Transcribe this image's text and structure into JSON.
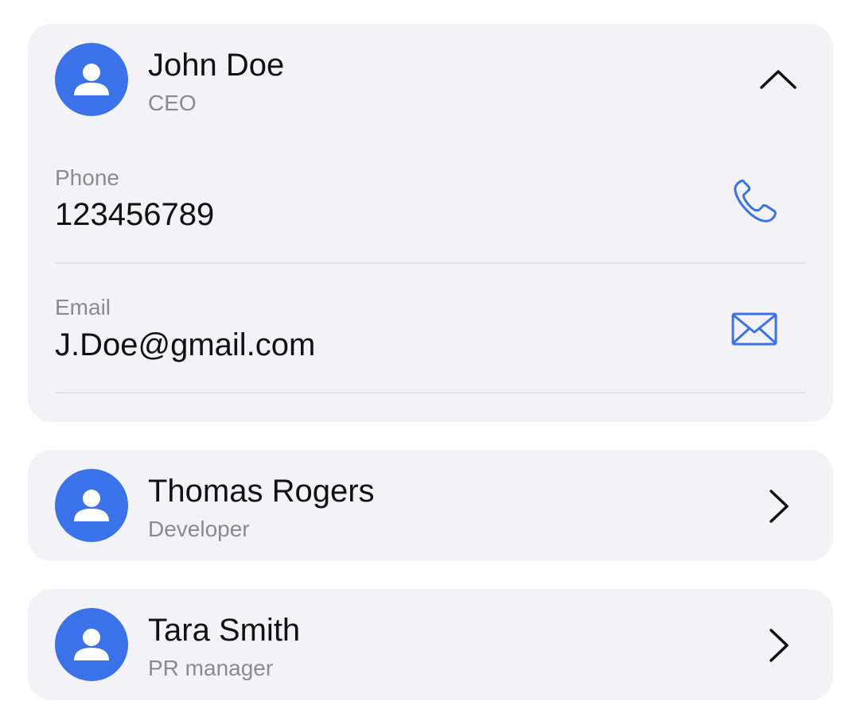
{
  "contacts": [
    {
      "name": "John Doe",
      "role": "CEO",
      "expanded": true,
      "avatar_icon": "person-icon",
      "toggle_icon": "chevron-up-icon",
      "fields": {
        "phone": {
          "label": "Phone",
          "value": "123456789",
          "icon": "phone-icon"
        },
        "email": {
          "label": "Email",
          "value": "J.Doe@gmail.com",
          "icon": "mail-icon"
        }
      }
    },
    {
      "name": "Thomas Rogers",
      "role": "Developer",
      "expanded": false,
      "avatar_icon": "person-icon",
      "toggle_icon": "chevron-right-icon"
    },
    {
      "name": "Tara Smith",
      "role": "PR manager",
      "expanded": false,
      "avatar_icon": "person-icon",
      "toggle_icon": "chevron-right-icon"
    }
  ],
  "colors": {
    "accent": "#3a72ea",
    "card_background": "#f3f2f7",
    "secondary_text": "#8b8a90",
    "primary_text": "#111111",
    "divider": "#e3e2e8"
  }
}
